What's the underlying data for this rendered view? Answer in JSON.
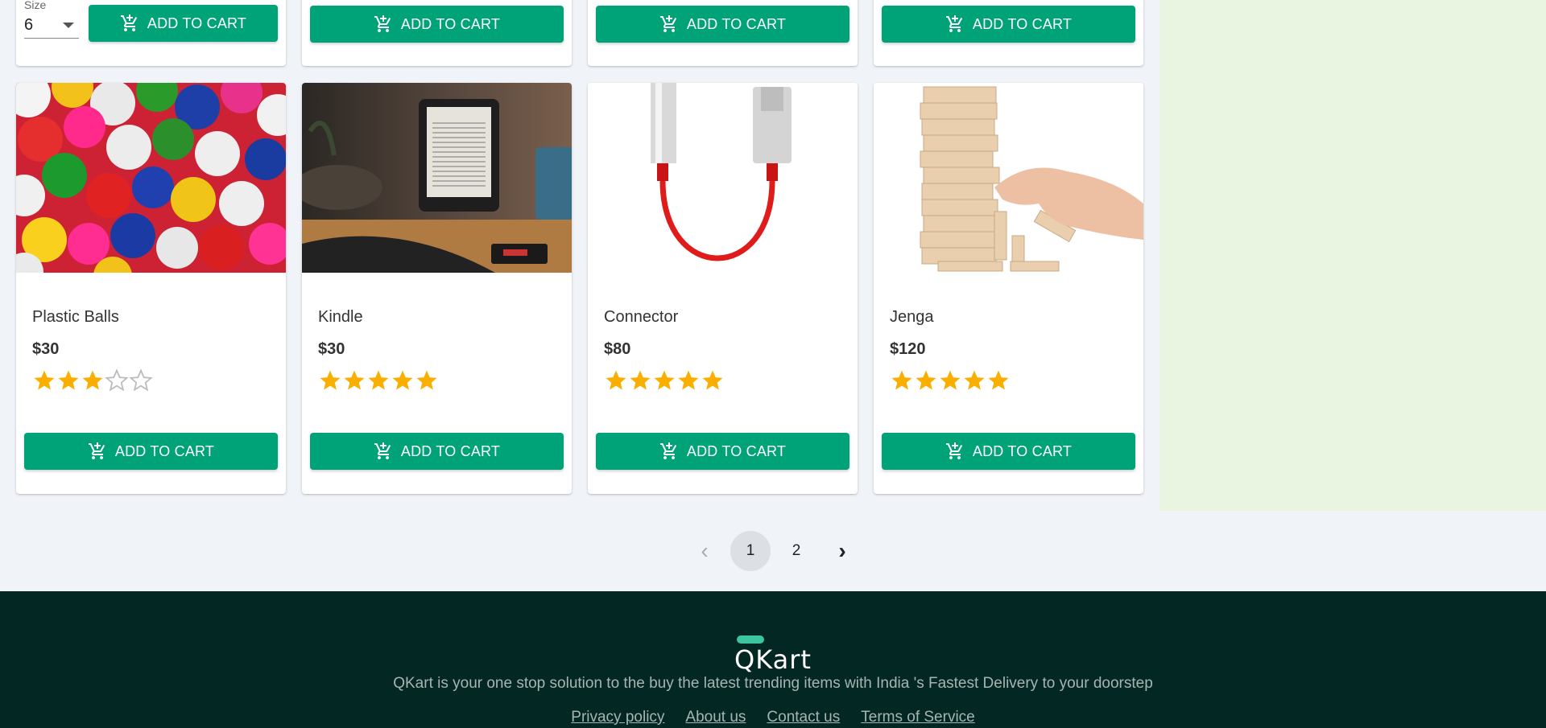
{
  "top_row": {
    "size_label": "Size",
    "size_value": "6",
    "add_to_cart": "ADD TO CART"
  },
  "products": [
    {
      "name": "Plastic Balls",
      "price": "$30",
      "rating": 3,
      "image": "colorful-balls"
    },
    {
      "name": "Kindle",
      "price": "$30",
      "rating": 5,
      "image": "kindle-on-desk"
    },
    {
      "name": "Connector",
      "price": "$80",
      "rating": 5,
      "image": "red-usb-c-connector"
    },
    {
      "name": "Jenga",
      "price": "$120",
      "rating": 5,
      "image": "wooden-jenga-tower"
    }
  ],
  "add_to_cart_label": "ADD TO CART",
  "pagination": {
    "prev": "‹",
    "pages": [
      "1",
      "2"
    ],
    "current": "1",
    "next": "›"
  },
  "footer": {
    "brand": "QKart",
    "tagline": "QKart is your one stop solution to the buy the latest trending items with India 's Fastest Delivery to your doorstep",
    "links": [
      "Privacy policy",
      "About us",
      "Contact us",
      "Terms of Service"
    ]
  },
  "colors": {
    "primary": "#00a278",
    "star": "#faaf00",
    "footer_bg": "#032723",
    "side_panel": "#e9f5e1"
  }
}
